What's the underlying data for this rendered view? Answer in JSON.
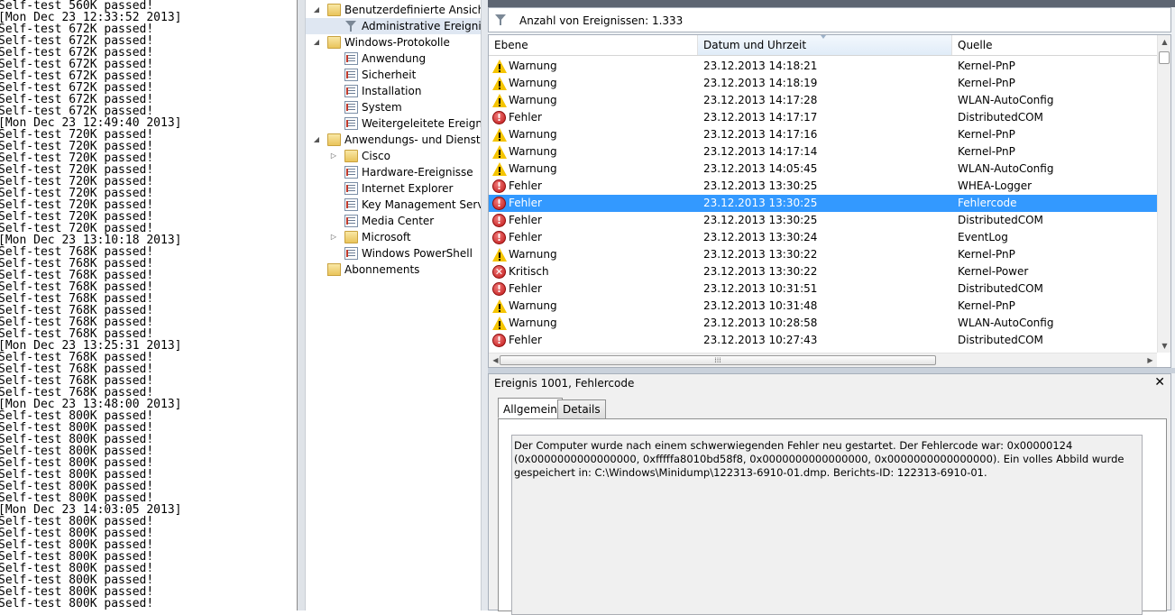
{
  "console": {
    "lines": [
      "Self-test 560K passed!",
      "[Mon Dec 23 12:33:52 2013]",
      "Self-test 672K passed!",
      "Self-test 672K passed!",
      "Self-test 672K passed!",
      "Self-test 672K passed!",
      "Self-test 672K passed!",
      "Self-test 672K passed!",
      "Self-test 672K passed!",
      "Self-test 672K passed!",
      "[Mon Dec 23 12:49:40 2013]",
      "Self-test 720K passed!",
      "Self-test 720K passed!",
      "Self-test 720K passed!",
      "Self-test 720K passed!",
      "Self-test 720K passed!",
      "Self-test 720K passed!",
      "Self-test 720K passed!",
      "Self-test 720K passed!",
      "Self-test 720K passed!",
      "[Mon Dec 23 13:10:18 2013]",
      "Self-test 768K passed!",
      "Self-test 768K passed!",
      "Self-test 768K passed!",
      "Self-test 768K passed!",
      "Self-test 768K passed!",
      "Self-test 768K passed!",
      "Self-test 768K passed!",
      "Self-test 768K passed!",
      "[Mon Dec 23 13:25:31 2013]",
      "Self-test 768K passed!",
      "Self-test 768K passed!",
      "Self-test 768K passed!",
      "Self-test 768K passed!",
      "[Mon Dec 23 13:48:00 2013]",
      "Self-test 800K passed!",
      "Self-test 800K passed!",
      "Self-test 800K passed!",
      "Self-test 800K passed!",
      "Self-test 800K passed!",
      "Self-test 800K passed!",
      "Self-test 800K passed!",
      "Self-test 800K passed!",
      "[Mon Dec 23 14:03:05 2013]",
      "Self-test 800K passed!",
      "Self-test 800K passed!",
      "Self-test 800K passed!",
      "Self-test 800K passed!",
      "Self-test 800K passed!",
      "Self-test 800K passed!",
      "Self-test 800K passed!",
      "Self-test 800K passed!"
    ]
  },
  "tree": {
    "nodes": [
      {
        "label": "Benutzerdefinierte Ansichten",
        "icon": "folder-icon",
        "twisty": "expanded",
        "level": 0
      },
      {
        "label": "Administrative Ereignisse",
        "icon": "filter-icon",
        "twisty": "",
        "level": 1
      },
      {
        "label": "Windows-Protokolle",
        "icon": "folder-icon",
        "twisty": "expanded",
        "level": 0
      },
      {
        "label": "Anwendung",
        "icon": "log-icon",
        "twisty": "",
        "level": 1
      },
      {
        "label": "Sicherheit",
        "icon": "log-icon",
        "twisty": "",
        "level": 1
      },
      {
        "label": "Installation",
        "icon": "log-icon",
        "twisty": "",
        "level": 1
      },
      {
        "label": "System",
        "icon": "log-icon",
        "twisty": "",
        "level": 1
      },
      {
        "label": "Weitergeleitete Ereignisse",
        "icon": "log-icon",
        "twisty": "",
        "level": 1
      },
      {
        "label": "Anwendungs- und Dienstprotokolle",
        "icon": "folder-icon",
        "twisty": "expanded",
        "level": 0
      },
      {
        "label": "Cisco",
        "icon": "folder-icon",
        "twisty": "collapsed",
        "level": 1
      },
      {
        "label": "Hardware-Ereignisse",
        "icon": "log-icon",
        "twisty": "",
        "level": 1
      },
      {
        "label": "Internet Explorer",
        "icon": "log-icon",
        "twisty": "",
        "level": 1
      },
      {
        "label": "Key Management Service",
        "icon": "log-icon",
        "twisty": "",
        "level": 1
      },
      {
        "label": "Media Center",
        "icon": "log-icon",
        "twisty": "",
        "level": 1
      },
      {
        "label": "Microsoft",
        "icon": "folder-icon",
        "twisty": "collapsed",
        "level": 1
      },
      {
        "label": "Windows PowerShell",
        "icon": "log-icon",
        "twisty": "",
        "level": 1
      },
      {
        "label": "Abonnements",
        "icon": "subscriptions-icon",
        "twisty": "",
        "level": 0
      }
    ]
  },
  "events": {
    "count_label": "Anzahl von Ereignissen: 1.333",
    "columns": [
      "Ebene",
      "Datum und Uhrzeit",
      "Quelle"
    ],
    "rows": [
      {
        "level": "Warnung",
        "type": "warning",
        "datetime": "23.12.2013 14:18:21",
        "source": "Kernel-PnP"
      },
      {
        "level": "Warnung",
        "type": "warning",
        "datetime": "23.12.2013 14:18:19",
        "source": "Kernel-PnP"
      },
      {
        "level": "Warnung",
        "type": "warning",
        "datetime": "23.12.2013 14:17:28",
        "source": "WLAN-AutoConfig"
      },
      {
        "level": "Fehler",
        "type": "error",
        "datetime": "23.12.2013 14:17:17",
        "source": "DistributedCOM"
      },
      {
        "level": "Warnung",
        "type": "warning",
        "datetime": "23.12.2013 14:17:16",
        "source": "Kernel-PnP"
      },
      {
        "level": "Warnung",
        "type": "warning",
        "datetime": "23.12.2013 14:17:14",
        "source": "Kernel-PnP"
      },
      {
        "level": "Warnung",
        "type": "warning",
        "datetime": "23.12.2013 14:05:45",
        "source": "WLAN-AutoConfig"
      },
      {
        "level": "Fehler",
        "type": "error",
        "datetime": "23.12.2013 13:30:25",
        "source": "WHEA-Logger"
      },
      {
        "level": "Fehler",
        "type": "error",
        "datetime": "23.12.2013 13:30:25",
        "source": "Fehlercode",
        "selected": true
      },
      {
        "level": "Fehler",
        "type": "error",
        "datetime": "23.12.2013 13:30:25",
        "source": "DistributedCOM"
      },
      {
        "level": "Fehler",
        "type": "error",
        "datetime": "23.12.2013 13:30:24",
        "source": "EventLog"
      },
      {
        "level": "Warnung",
        "type": "warning",
        "datetime": "23.12.2013 13:30:22",
        "source": "Kernel-PnP"
      },
      {
        "level": "Kritisch",
        "type": "critical",
        "datetime": "23.12.2013 13:30:22",
        "source": "Kernel-Power"
      },
      {
        "level": "Fehler",
        "type": "error",
        "datetime": "23.12.2013 10:31:51",
        "source": "DistributedCOM"
      },
      {
        "level": "Warnung",
        "type": "warning",
        "datetime": "23.12.2013 10:31:48",
        "source": "Kernel-PnP"
      },
      {
        "level": "Warnung",
        "type": "warning",
        "datetime": "23.12.2013 10:28:58",
        "source": "WLAN-AutoConfig"
      },
      {
        "level": "Fehler",
        "type": "error",
        "datetime": "23.12.2013 10:27:43",
        "source": "DistributedCOM"
      }
    ]
  },
  "detail": {
    "title": "Ereignis 1001, Fehlercode",
    "close": "✕",
    "tabs": [
      "Allgemein",
      "Details"
    ],
    "active_tab": "Allgemein",
    "message": "Der Computer wurde nach einem schwerwiegenden Fehler neu gestartet. Der Fehlercode war: 0x00000124 (0x0000000000000000, 0xfffffa8010bd58f8, 0x0000000000000000, 0x0000000000000000). Ein volles Abbild wurde gespeichert in: C:\\Windows\\Minidump\\122313-6910-01.dmp. Berichts-ID: 122313-6910-01."
  }
}
